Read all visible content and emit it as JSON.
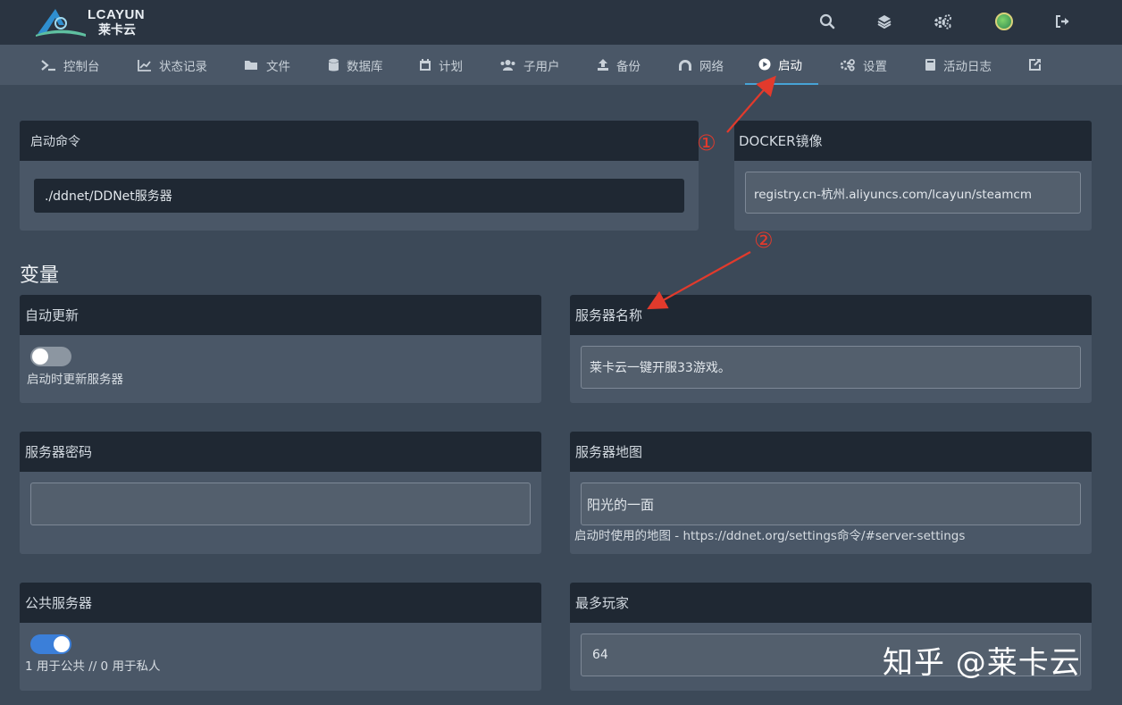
{
  "brand": {
    "name": "LCAYUN",
    "sub": "莱卡云"
  },
  "nav": {
    "items": [
      {
        "label": "控制台",
        "icon": "terminal-icon"
      },
      {
        "label": "状态记录",
        "icon": "chart-icon"
      },
      {
        "label": "文件",
        "icon": "folder-icon"
      },
      {
        "label": "数据库",
        "icon": "database-icon"
      },
      {
        "label": "计划",
        "icon": "calendar-icon"
      },
      {
        "label": "子用户",
        "icon": "users-icon"
      },
      {
        "label": "备份",
        "icon": "upload-icon"
      },
      {
        "label": "网络",
        "icon": "network-icon"
      },
      {
        "label": "启动",
        "icon": "play-icon",
        "active": true
      },
      {
        "label": "设置",
        "icon": "gears-icon"
      },
      {
        "label": "活动日志",
        "icon": "book-icon"
      }
    ]
  },
  "startup": {
    "title": "启动命令",
    "command": "./ddnet/DDNet服务器"
  },
  "docker": {
    "title": "DOCKER镜像",
    "image": "registry.cn-杭州.aliyuncs.com/lcayun/steamcm"
  },
  "variables": {
    "title": "变量",
    "auto_update": {
      "title": "自动更新",
      "enabled": false,
      "help": "启动时更新服务器"
    },
    "server_name": {
      "title": "服务器名称",
      "value": "莱卡云一键开服33游戏。"
    },
    "server_password": {
      "title": "服务器密码",
      "value": ""
    },
    "server_map": {
      "title": "服务器地图",
      "value": "阳光的一面",
      "help": "启动时使用的地图 - https://ddnet.org/settings命令/#server-settings"
    },
    "public_server": {
      "title": "公共服务器",
      "enabled": true,
      "help": "1 用于公共 // 0 用于私人"
    },
    "max_players": {
      "title": "最多玩家",
      "value": "64"
    }
  },
  "annotations": {
    "one": "①",
    "two": "②",
    "color": "#e23a2c"
  },
  "watermark": "知乎 @莱卡云",
  "colors": {
    "topbar": "#2a3441",
    "nav": "#4a5767",
    "page": "#3c4958",
    "card_head": "#1f2833",
    "accent": "#47a3d6",
    "toggle_on": "#3b7fd9"
  }
}
